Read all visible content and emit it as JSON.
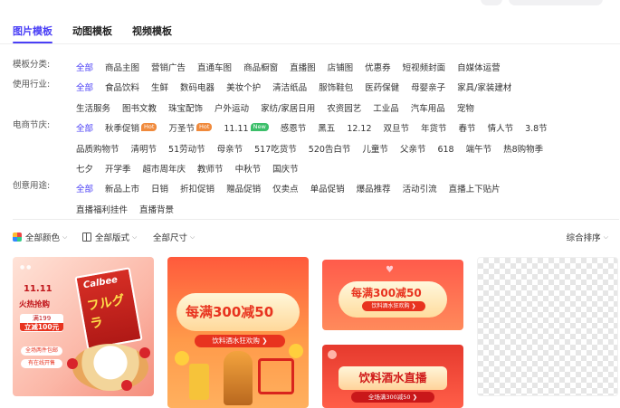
{
  "tabs": [
    {
      "label": "图片模板",
      "active": true
    },
    {
      "label": "动图模板",
      "active": false
    },
    {
      "label": "视频模板",
      "active": false
    }
  ],
  "filters": {
    "category": {
      "label": "模板分类:",
      "rows": [
        [
          "全部",
          "商品主图",
          "营销广告",
          "直通车图",
          "商品橱窗",
          "直播图",
          "店铺图",
          "优惠券",
          "短视频封面",
          "自媒体运营"
        ]
      ]
    },
    "industry": {
      "label": "使用行业:",
      "rows": [
        [
          "全部",
          "食品饮料",
          "生鲜",
          "数码电器",
          "美妆个护",
          "清洁纸品",
          "服饰鞋包",
          "医药保健",
          "母婴亲子",
          "家具/家装建材"
        ],
        [
          "生活服务",
          "图书文教",
          "珠宝配饰",
          "户外运动",
          "家纺/家居日用",
          "农资园艺",
          "工业品",
          "汽车用品",
          "宠物"
        ]
      ]
    },
    "festival": {
      "label": "电商节庆:",
      "rows": [
        [
          "全部",
          "秋季促销",
          "万圣节",
          "11.11",
          "感恩节",
          "黑五",
          "12.12",
          "双旦节",
          "年货节",
          "春节",
          "情人节",
          "3.8节"
        ],
        [
          "品质购物节",
          "清明节",
          "51劳动节",
          "母亲节",
          "517吃货节",
          "520告白节",
          "儿童节",
          "父亲节",
          "618",
          "端午节",
          "热8购物季"
        ],
        [
          "七夕",
          "开学季",
          "超市周年庆",
          "教师节",
          "中秋节",
          "国庆节"
        ]
      ],
      "badges": {
        "秋季促销": "Hot",
        "万圣节": "Hot",
        "11.11": "New"
      }
    },
    "usage": {
      "label": "创意用途:",
      "rows": [
        [
          "全部",
          "新品上市",
          "日销",
          "折扣促销",
          "赠品促销",
          "仅卖点",
          "单品促销",
          "爆品推荐",
          "活动引流",
          "直播上下贴片"
        ],
        [
          "直播福利挂件",
          "直播背景"
        ]
      ]
    }
  },
  "sortbar": {
    "color": "全部颜色",
    "layout": "全部版式",
    "size": "全部尺寸",
    "sort": "综合排序"
  },
  "cards": {
    "card1": {
      "date": "11.11",
      "title": "火热抢购",
      "tag_line1": "满199",
      "tag_line2": "立减100元",
      "pill1": "全场两件包邮",
      "pill2": "有在线开售",
      "brand": "Calbee",
      "kana": "フルグラ"
    },
    "card2": {
      "headline": "每满300减50",
      "sub": "饮料酒水狂欢购 ❯"
    },
    "card3": {
      "headline": "每满300减50",
      "sub": "饮料酒水狂欢购 ❯"
    },
    "card4": {
      "headline": "饮料酒水直播",
      "sub": "全场满300减50 ❯"
    }
  },
  "colors": {
    "accent": "#4a3ff6",
    "hot_badge": "#f08a3c",
    "new_badge": "#3cbf6a",
    "promo_red": "#e8331f"
  }
}
